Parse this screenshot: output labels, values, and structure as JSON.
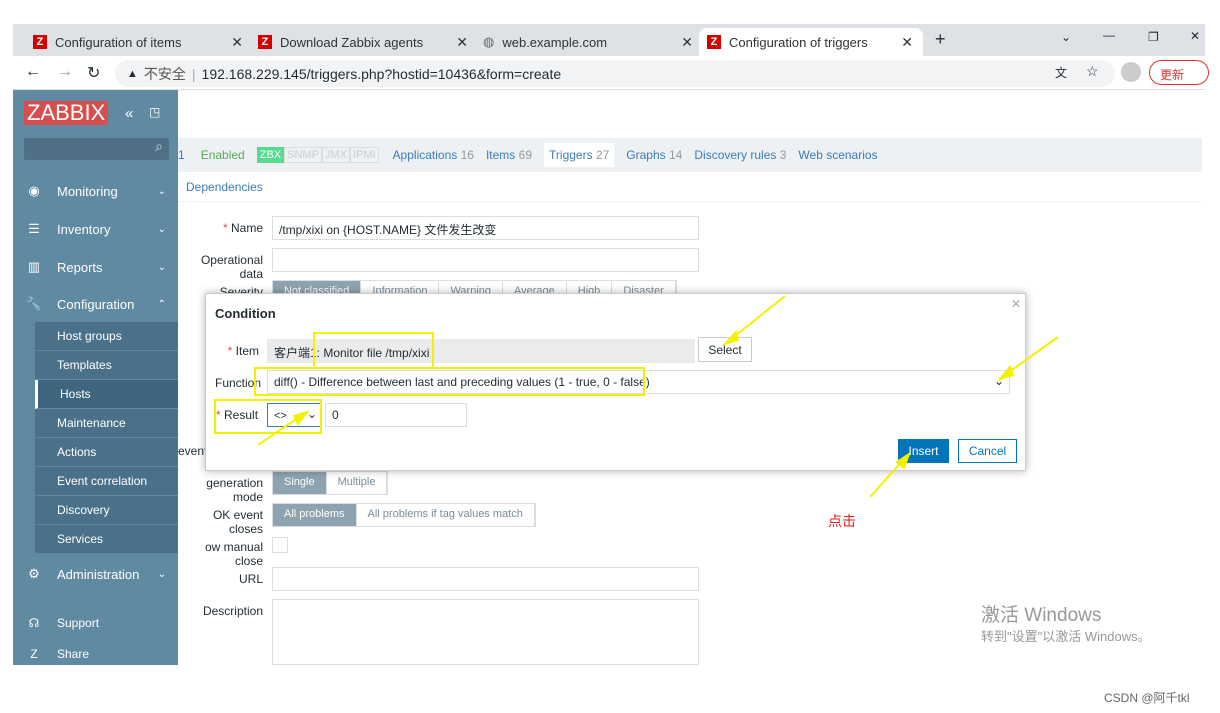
{
  "browser": {
    "tabs": [
      {
        "title": "Configuration of items",
        "icon": "zabbix-icon"
      },
      {
        "title": "Download Zabbix agents",
        "icon": "zabbix-icon"
      },
      {
        "title": "web.example.com",
        "icon": "globe-icon"
      },
      {
        "title": "Configuration of triggers",
        "icon": "zabbix-icon",
        "active": true
      }
    ],
    "security": "不安全",
    "url": "192.168.229.145/triggers.php?hostid=10436&form=create",
    "update_label": "更新"
  },
  "sidebar": {
    "logo": "ZABBIX",
    "menu": [
      {
        "label": "Monitoring",
        "icon": "eye-icon"
      },
      {
        "label": "Inventory",
        "icon": "list-icon"
      },
      {
        "label": "Reports",
        "icon": "chart-icon"
      },
      {
        "label": "Configuration",
        "icon": "wrench-icon"
      }
    ],
    "submenu": [
      "Host groups",
      "Templates",
      "Hosts",
      "Maintenance",
      "Actions",
      "Event correlation",
      "Discovery",
      "Services"
    ],
    "admin": "Administration",
    "support": "Support",
    "share": "Share"
  },
  "host_tabs": {
    "prefix": "1",
    "status": "Enabled",
    "badges": [
      "ZBX",
      "SNMP",
      "JMX",
      "IPMI"
    ],
    "links": [
      {
        "label": "Applications",
        "count": "16"
      },
      {
        "label": "Items",
        "count": "69"
      },
      {
        "label": "Triggers",
        "count": "27"
      },
      {
        "label": "Graphs",
        "count": "14"
      },
      {
        "label": "Discovery rules",
        "count": "3"
      },
      {
        "label": "Web scenarios",
        "count": ""
      }
    ]
  },
  "form": {
    "dependencies_tab": "Dependencies",
    "name_label": "Name",
    "name_value": "/tmp/xixi on {HOST.NAME} 文件发生改变",
    "opdata_label": "Operational data",
    "severity_label": "Severity",
    "severities": [
      "Not classified",
      "Information",
      "Warning",
      "Average",
      "High",
      "Disaster"
    ],
    "event_label": "event",
    "genmode_label": "generation mode",
    "genmode": [
      "Single",
      "Multiple"
    ],
    "okclose_label": "OK event closes",
    "okclose": [
      "All problems",
      "All problems if tag values match"
    ],
    "manualclose_label": "ow manual close",
    "url_label": "URL",
    "desc_label": "Description"
  },
  "modal": {
    "title": "Condition",
    "item_label": "Item",
    "item_value": "客户端1: Monitor file /tmp/xixi",
    "select": "Select",
    "function_label": "Function",
    "function_value": "diff() - Difference between last and preceding values (1 - true, 0 - false)",
    "result_label": "Result",
    "operator": "<>",
    "result_value": "0",
    "insert": "Insert",
    "cancel": "Cancel"
  },
  "annotation": "点击",
  "watermark": {
    "line1": "激活 Windows",
    "line2": "转到\"设置\"以激活 Windows。"
  },
  "csdn": "CSDN @阿千tkl"
}
